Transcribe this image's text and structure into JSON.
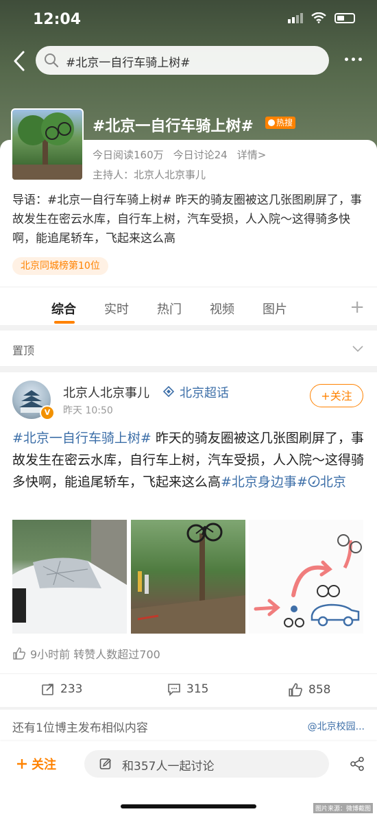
{
  "status": {
    "time": "12:04"
  },
  "search": {
    "query": "#北京一自行车骑上树#"
  },
  "topic": {
    "title": "#北京一自行车骑上树#",
    "hot_badge": "热搜",
    "reads": "今日阅读160万",
    "discussions": "今日讨论24",
    "details": "详情>",
    "host": "主持人：北京人北京事儿",
    "intro": "导语：#北京一自行车骑上树# 昨天的骑友圈被这几张图刷屏了，事故发生在密云水库，自行车上树，汽车受损，人入院～这得骑多快啊，能追尾轿车，飞起来这么高",
    "rank_badge": "北京同城榜第10位"
  },
  "tabs": [
    {
      "label": "综合"
    },
    {
      "label": "实时"
    },
    {
      "label": "热门"
    },
    {
      "label": "视频"
    },
    {
      "label": "图片"
    }
  ],
  "tab_plus": "+",
  "pinned": {
    "label": "置顶"
  },
  "post": {
    "author": "北京人北京事儿",
    "super_topic": "北京超话",
    "time": "昨天 10:50",
    "follow": "+关注",
    "avatar_badge": "V",
    "text_link1": "#北京一自行车骑上树#",
    "text_body": " 昨天的骑友圈被这几张图刷屏了，事故发生在密云水库，自行车上树，汽车受损，人入院～这得骑多快啊，能追尾轿车，飞起来这么高",
    "text_link2": "#北京身边事#",
    "text_link3": "北京",
    "repost_info": "9小时前 转赞人数超过700",
    "reposts": "233",
    "comments": "315",
    "likes": "858"
  },
  "similar": {
    "text": "还有1位博主发布相似内容",
    "source": "@北京校园..."
  },
  "bottom": {
    "follow": "关注",
    "discuss_placeholder": "和357人一起讨论"
  },
  "watermark": "图片来源：微博截图",
  "colors": {
    "accent": "#ff8200",
    "link": "#3d6fa8"
  }
}
